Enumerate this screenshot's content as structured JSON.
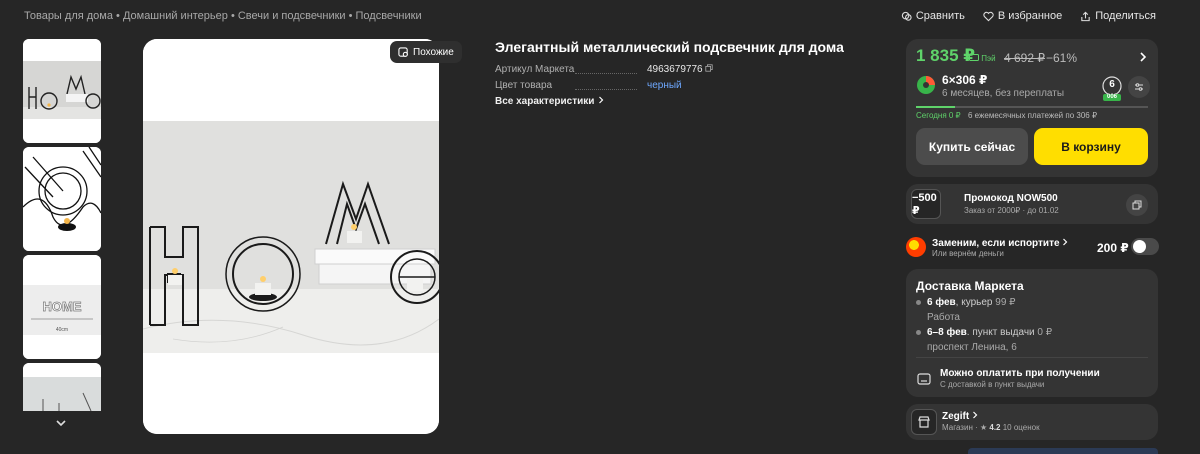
{
  "breadcrumbs": {
    "item1": "Товары для дома",
    "sep1": " • ",
    "item2": "Домашний интерьер",
    "sep2": " • ",
    "item3": "Свечи и подсвечники",
    "sep3": " • ",
    "item4": "Подсвечники"
  },
  "top_actions": {
    "compare": "Сравнить",
    "favorite": "В избранное",
    "share": "Поделиться"
  },
  "gallery": {
    "similar_label": "Похожие",
    "thumb4_caption": "HOME",
    "thumb3_caption": "40cm"
  },
  "product": {
    "title": "Элегантный металлический подсвечник для дома",
    "article_label": "Артикул Маркета",
    "article_value": "4963679776",
    "color_label": "Цвет товара",
    "color_value": "черный",
    "all_specs": "Все характеристики"
  },
  "price_card": {
    "price": "1 835 ₽",
    "pay_badge": "Пэй",
    "old_price": "4 692 ₽",
    "discount": "−61%",
    "split_amount": "6×306 ₽",
    "split_sub": "6 месяцев, без переплаты",
    "months": "6",
    "months_badge": "006",
    "progress": 0.17,
    "today": "Сегодня 0 ₽",
    "payments": "6 ежемесячных платежей по 306 ₽",
    "buy_now": "Купить сейчас",
    "add_to_cart": "В корзину",
    "accent_green": "#5fd36a",
    "accent_yellow": "#ffde00"
  },
  "promo": {
    "value": "−500 ₽",
    "title": "Промокод NOW500",
    "sub": "Заказ от 2000₽ · до 01.02"
  },
  "insurance": {
    "title": "Заменим, если испортите",
    "sub": "Или вернём деньги",
    "price": "200 ₽",
    "enabled": false
  },
  "delivery": {
    "title": "Доставка Маркета",
    "courier_date": "6 фев",
    "courier_text": ", курьер",
    "courier_price": " 99 ₽",
    "courier_sub": "Работа",
    "pickup_date": "6–8 фев",
    "pickup_text": ". пункт выдачи",
    "pickup_price": " 0 ₽",
    "pickup_sub": "проспект Ленина, 6",
    "cash_title": "Можно оплатить при получении",
    "cash_sub": "С доставкой в пункт выдачи"
  },
  "shop": {
    "name": "Zegift",
    "type": "Магазин",
    "rating": "4.2",
    "reviews": "10 оценок"
  }
}
